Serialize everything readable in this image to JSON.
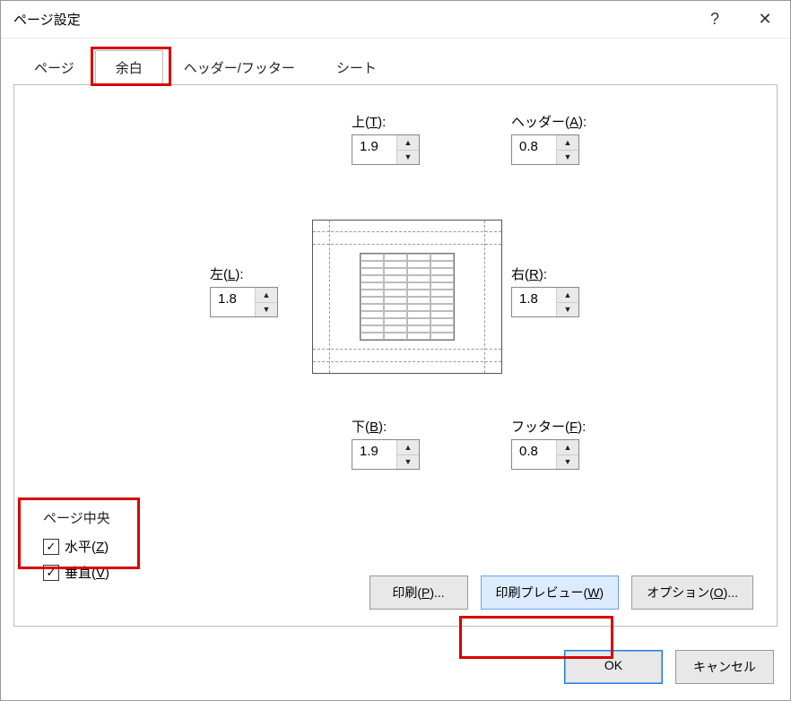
{
  "window": {
    "title": "ページ設定"
  },
  "tabs": {
    "page": "ページ",
    "margins": "余白",
    "headerfooter": "ヘッダー/フッター",
    "sheet": "シート"
  },
  "margins": {
    "top": {
      "label_pre": "上(",
      "key": "T",
      "label_post": "):",
      "value": "1.9"
    },
    "header": {
      "label_pre": "ヘッダー(",
      "key": "A",
      "label_post": "):",
      "value": "0.8"
    },
    "left": {
      "label_pre": "左(",
      "key": "L",
      "label_post": "):",
      "value": "1.8"
    },
    "right": {
      "label_pre": "右(",
      "key": "R",
      "label_post": "):",
      "value": "1.8"
    },
    "bottom": {
      "label_pre": "下(",
      "key": "B",
      "label_post": "):",
      "value": "1.9"
    },
    "footer": {
      "label_pre": "フッター(",
      "key": "F",
      "label_post": "):",
      "value": "0.8"
    }
  },
  "center": {
    "group_label": "ページ中央",
    "horizontal": {
      "pre": "水平(",
      "key": "Z",
      "post": ")",
      "checked": true
    },
    "vertical": {
      "pre": "垂直(",
      "key": "V",
      "post": ")",
      "checked": true
    }
  },
  "buttons": {
    "print": {
      "pre": "印刷(",
      "key": "P",
      "post": ")..."
    },
    "preview": {
      "pre": "印刷プレビュー(",
      "key": "W",
      "post": ")"
    },
    "options": {
      "pre": "オプション(",
      "key": "O",
      "post": ")..."
    },
    "ok": "OK",
    "cancel": "キャンセル"
  },
  "titlebar": {
    "help": "?",
    "close": "✕"
  }
}
